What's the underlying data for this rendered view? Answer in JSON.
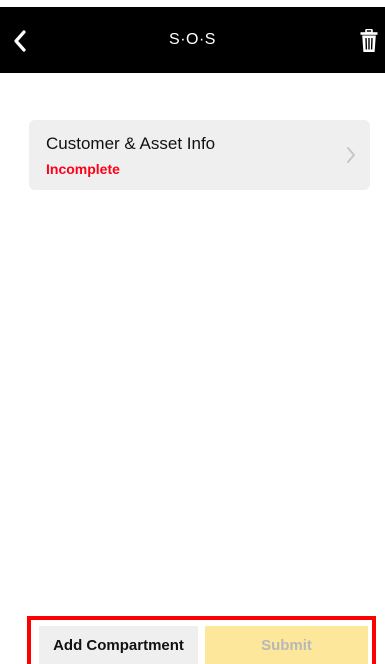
{
  "header": {
    "title": "S·O·S",
    "back_icon": "chevron-left-icon",
    "trash_icon": "trash-icon"
  },
  "card": {
    "title": "Customer & Asset Info",
    "status": "Incomplete",
    "chevron_icon": "chevron-right-icon"
  },
  "bottom": {
    "add_label": "Add Compartment",
    "submit_label": "Submit"
  },
  "colors": {
    "header_bg": "#000000",
    "card_bg": "#efefef",
    "status_red": "#ff0019",
    "highlight_border": "#ff0000",
    "submit_bg": "#fde79a",
    "submit_text": "#b8b8b8"
  }
}
